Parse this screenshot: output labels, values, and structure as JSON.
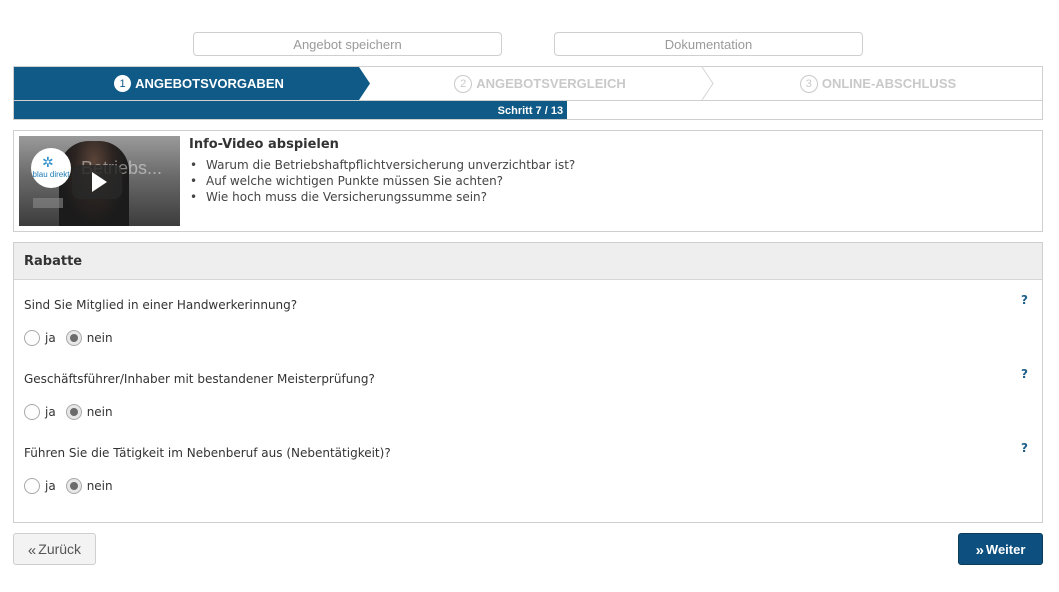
{
  "top_buttons": {
    "save_offer": "Angebot speichern",
    "documentation": "Dokumentation"
  },
  "stepper": {
    "steps": [
      {
        "num": "1",
        "label": "ANGEBOTSVORGABEN",
        "state": "active"
      },
      {
        "num": "2",
        "label": "ANGEBOTSVERGLEICH",
        "state": "inactive"
      },
      {
        "num": "3",
        "label": "ONLINE-ABSCHLUSS",
        "state": "inactive"
      }
    ],
    "progress_label": "Schritt 7 / 13",
    "progress_fraction": 0.538,
    "active_color": "#0f5a86"
  },
  "video": {
    "title": "Info-Video abspielen",
    "thumbnail_overlay": "Betriebs...",
    "logo_text": "blau direkt",
    "bullets": [
      "Warum die Betriebshaftpflichtversicherung unverzichtbar ist?",
      "Auf welche wichtigen Punkte müssen Sie achten?",
      "Wie hoch muss die Versicherungssumme sein?"
    ]
  },
  "rabatte": {
    "title": "Rabatte",
    "help_label": "?",
    "questions": [
      {
        "text": "Sind Sie Mitglied in einer Handwerkerinnung?",
        "options": [
          "ja",
          "nein"
        ],
        "selected": "nein"
      },
      {
        "text": "Geschäftsführer/Inhaber mit bestandener Meisterprüfung?",
        "options": [
          "ja",
          "nein"
        ],
        "selected": "nein"
      },
      {
        "text": "Führen Sie die Tätigkeit im Nebenberuf aus (Nebentätigkeit)?",
        "options": [
          "ja",
          "nein"
        ],
        "selected": "nein"
      }
    ]
  },
  "nav": {
    "back_icon": "«",
    "back_label": "Zurück",
    "next_icon": "»",
    "next_label": "Weiter",
    "next_color": "#0d5080"
  }
}
